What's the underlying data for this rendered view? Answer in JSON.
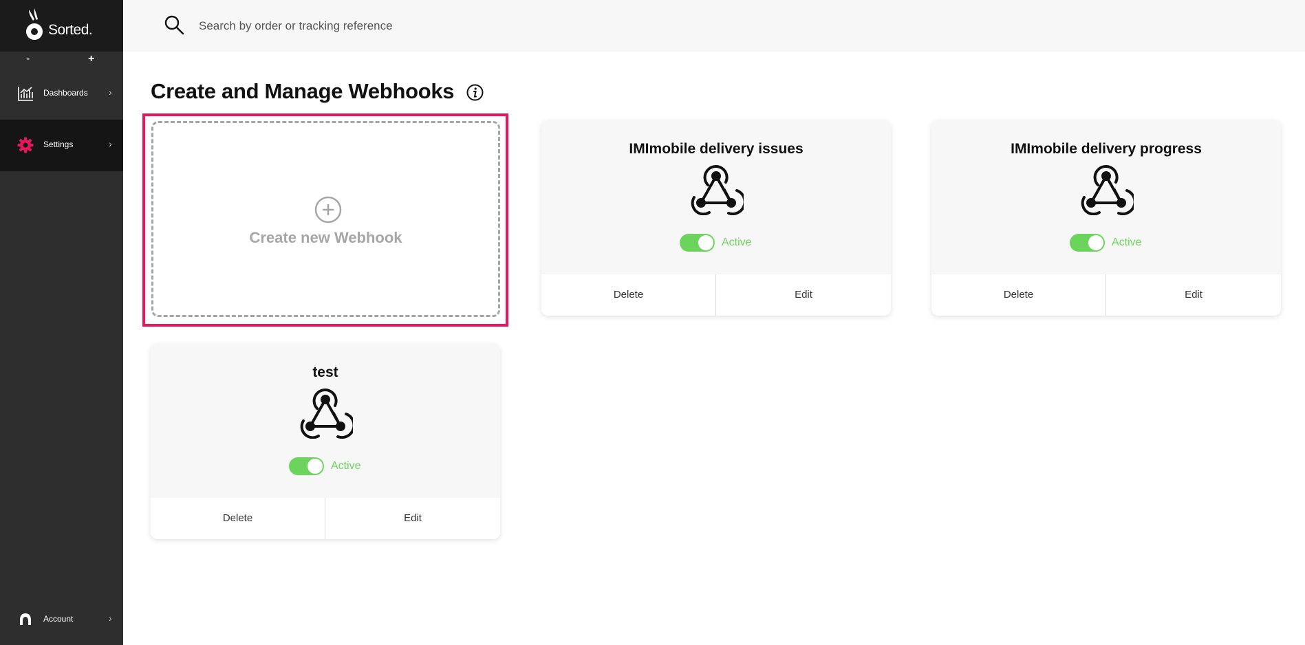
{
  "brand": {
    "name": "Sorted.",
    "accent_color": "#e8175d",
    "sidebar_color": "#2e2e2e",
    "active_color": "#6cd45c"
  },
  "zoom": {
    "minus": "-",
    "plus": "+"
  },
  "sidebar": {
    "items": [
      {
        "label": "Dashboards",
        "icon": "chart-icon"
      },
      {
        "label": "Settings",
        "icon": "gear-icon",
        "active": true
      }
    ],
    "account": {
      "label": "Account",
      "icon": "user-icon"
    },
    "chevron": "›"
  },
  "search": {
    "placeholder": "Search by order or tracking reference",
    "icon": "search-icon"
  },
  "page": {
    "title": "Create and Manage Webhooks",
    "info_icon": "info-icon"
  },
  "create": {
    "label": "Create new Webhook",
    "icon": "plus-circle-icon"
  },
  "webhooks": [
    {
      "title": "IMImobile delivery issues",
      "status": "Active",
      "delete_label": "Delete",
      "edit_label": "Edit"
    },
    {
      "title": "IMImobile delivery progress",
      "status": "Active",
      "delete_label": "Delete",
      "edit_label": "Edit"
    },
    {
      "title": "test",
      "status": "Active",
      "delete_label": "Delete",
      "edit_label": "Edit"
    }
  ]
}
